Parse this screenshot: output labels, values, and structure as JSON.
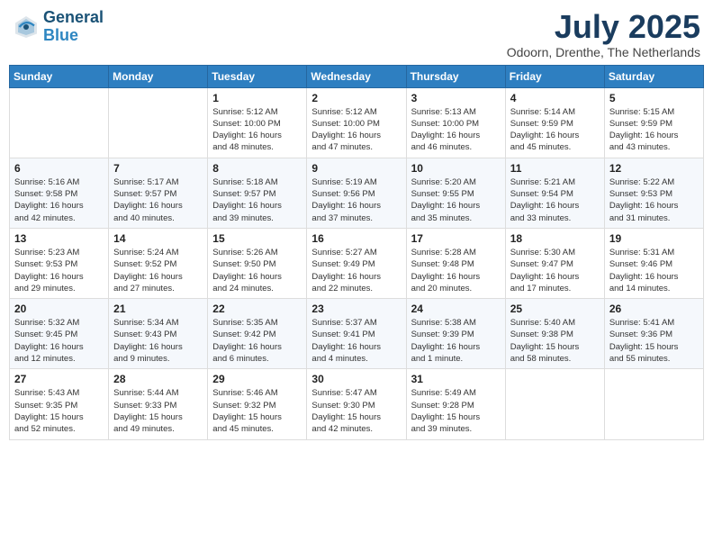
{
  "header": {
    "logo_line1": "General",
    "logo_line2": "Blue",
    "month_title": "July 2025",
    "location": "Odoorn, Drenthe, The Netherlands"
  },
  "weekdays": [
    "Sunday",
    "Monday",
    "Tuesday",
    "Wednesday",
    "Thursday",
    "Friday",
    "Saturday"
  ],
  "weeks": [
    [
      {
        "day": "",
        "info": ""
      },
      {
        "day": "",
        "info": ""
      },
      {
        "day": "1",
        "info": "Sunrise: 5:12 AM\nSunset: 10:00 PM\nDaylight: 16 hours\nand 48 minutes."
      },
      {
        "day": "2",
        "info": "Sunrise: 5:12 AM\nSunset: 10:00 PM\nDaylight: 16 hours\nand 47 minutes."
      },
      {
        "day": "3",
        "info": "Sunrise: 5:13 AM\nSunset: 10:00 PM\nDaylight: 16 hours\nand 46 minutes."
      },
      {
        "day": "4",
        "info": "Sunrise: 5:14 AM\nSunset: 9:59 PM\nDaylight: 16 hours\nand 45 minutes."
      },
      {
        "day": "5",
        "info": "Sunrise: 5:15 AM\nSunset: 9:59 PM\nDaylight: 16 hours\nand 43 minutes."
      }
    ],
    [
      {
        "day": "6",
        "info": "Sunrise: 5:16 AM\nSunset: 9:58 PM\nDaylight: 16 hours\nand 42 minutes."
      },
      {
        "day": "7",
        "info": "Sunrise: 5:17 AM\nSunset: 9:57 PM\nDaylight: 16 hours\nand 40 minutes."
      },
      {
        "day": "8",
        "info": "Sunrise: 5:18 AM\nSunset: 9:57 PM\nDaylight: 16 hours\nand 39 minutes."
      },
      {
        "day": "9",
        "info": "Sunrise: 5:19 AM\nSunset: 9:56 PM\nDaylight: 16 hours\nand 37 minutes."
      },
      {
        "day": "10",
        "info": "Sunrise: 5:20 AM\nSunset: 9:55 PM\nDaylight: 16 hours\nand 35 minutes."
      },
      {
        "day": "11",
        "info": "Sunrise: 5:21 AM\nSunset: 9:54 PM\nDaylight: 16 hours\nand 33 minutes."
      },
      {
        "day": "12",
        "info": "Sunrise: 5:22 AM\nSunset: 9:53 PM\nDaylight: 16 hours\nand 31 minutes."
      }
    ],
    [
      {
        "day": "13",
        "info": "Sunrise: 5:23 AM\nSunset: 9:53 PM\nDaylight: 16 hours\nand 29 minutes."
      },
      {
        "day": "14",
        "info": "Sunrise: 5:24 AM\nSunset: 9:52 PM\nDaylight: 16 hours\nand 27 minutes."
      },
      {
        "day": "15",
        "info": "Sunrise: 5:26 AM\nSunset: 9:50 PM\nDaylight: 16 hours\nand 24 minutes."
      },
      {
        "day": "16",
        "info": "Sunrise: 5:27 AM\nSunset: 9:49 PM\nDaylight: 16 hours\nand 22 minutes."
      },
      {
        "day": "17",
        "info": "Sunrise: 5:28 AM\nSunset: 9:48 PM\nDaylight: 16 hours\nand 20 minutes."
      },
      {
        "day": "18",
        "info": "Sunrise: 5:30 AM\nSunset: 9:47 PM\nDaylight: 16 hours\nand 17 minutes."
      },
      {
        "day": "19",
        "info": "Sunrise: 5:31 AM\nSunset: 9:46 PM\nDaylight: 16 hours\nand 14 minutes."
      }
    ],
    [
      {
        "day": "20",
        "info": "Sunrise: 5:32 AM\nSunset: 9:45 PM\nDaylight: 16 hours\nand 12 minutes."
      },
      {
        "day": "21",
        "info": "Sunrise: 5:34 AM\nSunset: 9:43 PM\nDaylight: 16 hours\nand 9 minutes."
      },
      {
        "day": "22",
        "info": "Sunrise: 5:35 AM\nSunset: 9:42 PM\nDaylight: 16 hours\nand 6 minutes."
      },
      {
        "day": "23",
        "info": "Sunrise: 5:37 AM\nSunset: 9:41 PM\nDaylight: 16 hours\nand 4 minutes."
      },
      {
        "day": "24",
        "info": "Sunrise: 5:38 AM\nSunset: 9:39 PM\nDaylight: 16 hours\nand 1 minute."
      },
      {
        "day": "25",
        "info": "Sunrise: 5:40 AM\nSunset: 9:38 PM\nDaylight: 15 hours\nand 58 minutes."
      },
      {
        "day": "26",
        "info": "Sunrise: 5:41 AM\nSunset: 9:36 PM\nDaylight: 15 hours\nand 55 minutes."
      }
    ],
    [
      {
        "day": "27",
        "info": "Sunrise: 5:43 AM\nSunset: 9:35 PM\nDaylight: 15 hours\nand 52 minutes."
      },
      {
        "day": "28",
        "info": "Sunrise: 5:44 AM\nSunset: 9:33 PM\nDaylight: 15 hours\nand 49 minutes."
      },
      {
        "day": "29",
        "info": "Sunrise: 5:46 AM\nSunset: 9:32 PM\nDaylight: 15 hours\nand 45 minutes."
      },
      {
        "day": "30",
        "info": "Sunrise: 5:47 AM\nSunset: 9:30 PM\nDaylight: 15 hours\nand 42 minutes."
      },
      {
        "day": "31",
        "info": "Sunrise: 5:49 AM\nSunset: 9:28 PM\nDaylight: 15 hours\nand 39 minutes."
      },
      {
        "day": "",
        "info": ""
      },
      {
        "day": "",
        "info": ""
      }
    ]
  ]
}
